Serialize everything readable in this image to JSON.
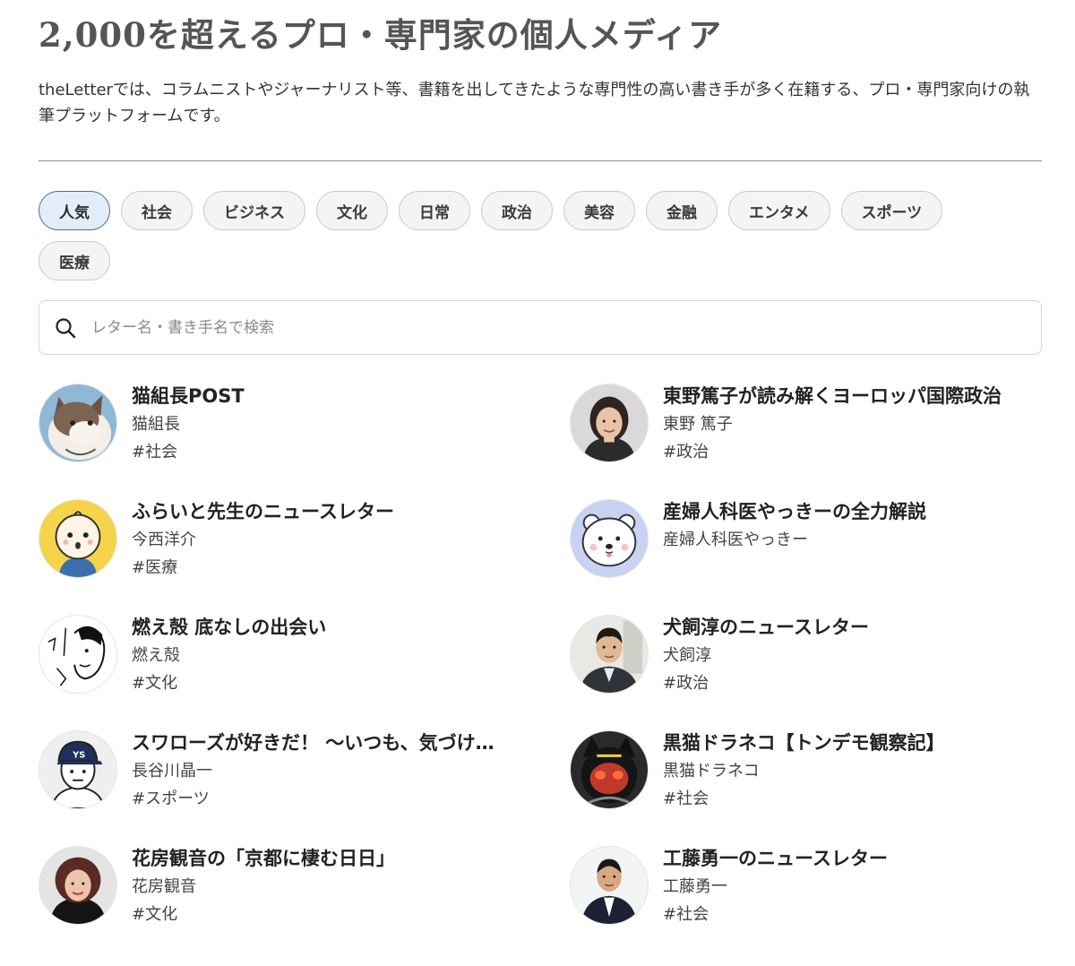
{
  "header": {
    "title": "2,000を超えるプロ・専門家の個人メディア",
    "description": "theLetterでは、コラムニストやジャーナリスト等、書籍を出してきたような専門性の高い書き手が多く在籍する、プロ・専門家向けの執筆プラットフォームです。"
  },
  "categories": [
    {
      "label": "人気",
      "active": true
    },
    {
      "label": "社会"
    },
    {
      "label": "ビジネス"
    },
    {
      "label": "文化"
    },
    {
      "label": "日常"
    },
    {
      "label": "政治"
    },
    {
      "label": "美容"
    },
    {
      "label": "金融"
    },
    {
      "label": "エンタメ"
    },
    {
      "label": "スポーツ"
    },
    {
      "label": "医療"
    }
  ],
  "search": {
    "placeholder": "レター名・書き手名で検索",
    "icon": "search-icon"
  },
  "letters": [
    {
      "title": "猫組長POST",
      "author": "猫組長",
      "tag": "#社会",
      "avatar": "cat-illustration-avatar"
    },
    {
      "title": "東野篤子が読み解くヨーロッパ国際政治",
      "author": "東野 篤子",
      "tag": "#政治",
      "avatar": "woman-portrait-avatar"
    },
    {
      "title": "ふらいと先生のニュースレター",
      "author": "今西洋介",
      "tag": "#医療",
      "avatar": "baby-illustration-avatar"
    },
    {
      "title": "産婦人科医やっきーの全力解説",
      "author": "産婦人科医やっきー",
      "tag": "",
      "avatar": "polar-bear-illustration-avatar"
    },
    {
      "title": "燃え殻 底なしの出会い",
      "author": "燃え殻",
      "tag": "#文化",
      "avatar": "sketch-illustration-avatar"
    },
    {
      "title": "犬飼淳のニュースレター",
      "author": "犬飼淳",
      "tag": "#政治",
      "avatar": "man-portrait-avatar"
    },
    {
      "title": "スワローズが好きだ！ 〜いつも、気づけ…",
      "author": "長谷川晶一",
      "tag": "#スポーツ",
      "avatar": "cap-man-illustration-avatar"
    },
    {
      "title": "黒猫ドラネコ【トンデモ観察記】",
      "author": "黒猫ドラネコ",
      "tag": "#社会",
      "avatar": "black-cat-mask-avatar"
    },
    {
      "title": "花房観音の「京都に棲む日日」",
      "author": "花房観音",
      "tag": "#文化",
      "avatar": "woman-portrait-avatar"
    },
    {
      "title": "工藤勇一のニュースレター",
      "author": "工藤勇一",
      "tag": "#社会",
      "avatar": "man-suit-portrait-avatar"
    }
  ]
}
